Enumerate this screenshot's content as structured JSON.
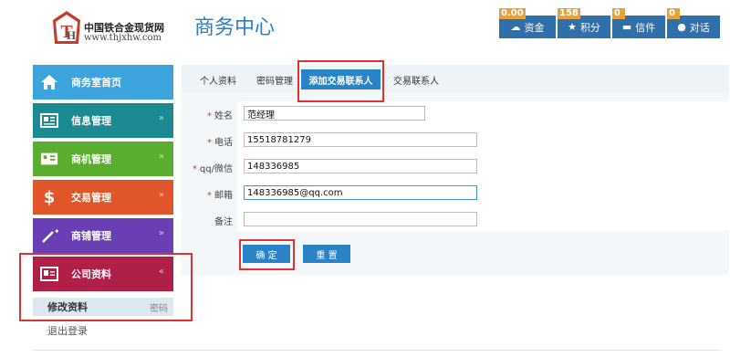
{
  "header": {
    "logo_title": "中国铁合金现货网",
    "logo_url": "www.thjxhw.com",
    "page_heading": "商务中心",
    "buttons": [
      {
        "label": "资金",
        "badge": "0.00",
        "icon": "cloud-icon"
      },
      {
        "label": "积分",
        "badge": "158",
        "icon": "star-icon"
      },
      {
        "label": "信件",
        "badge": "0",
        "icon": "mail-icon"
      },
      {
        "label": "对话",
        "badge": "0",
        "icon": "chat-icon"
      }
    ]
  },
  "sidebar": {
    "items": [
      {
        "label": "商务室首页",
        "color": "#3da3dc",
        "icon": "home-icon"
      },
      {
        "label": "信息管理",
        "color": "#1b8a93",
        "icon": "newspaper-icon"
      },
      {
        "label": "商机管理",
        "color": "#5aad2e",
        "icon": "opportunity-icon"
      },
      {
        "label": "交易管理",
        "color": "#e0562a",
        "icon": "money-icon"
      },
      {
        "label": "商铺管理",
        "color": "#6a3fb4",
        "icon": "wand-icon"
      },
      {
        "label": "公司资料",
        "color": "#b01f47",
        "icon": "id-card-icon"
      }
    ],
    "sub_active": "修改资料",
    "sub_password": "密码",
    "logout": "退出登录"
  },
  "tabs": {
    "items": [
      "个人资料",
      "密码管理",
      "添加交易联系人",
      "交易联系人"
    ],
    "active": "添加交易联系人"
  },
  "form": {
    "fields": [
      {
        "label": "姓名",
        "required": true,
        "value": "范经理"
      },
      {
        "label": "电话",
        "required": true,
        "value": "15518781279"
      },
      {
        "label": "qq/微信",
        "required": true,
        "value": "148336985"
      },
      {
        "label": "邮箱",
        "required": true,
        "value": "148336985@qq.com"
      },
      {
        "label": "备注",
        "required": false,
        "value": ""
      }
    ],
    "submit_label": "确 定",
    "reset_label": "重 置"
  },
  "colors": {
    "accent": "#2a83c7",
    "highlight": "#e0302f"
  }
}
